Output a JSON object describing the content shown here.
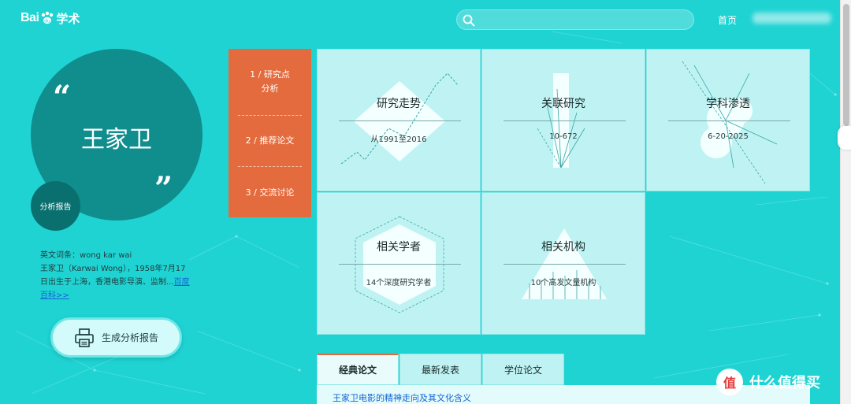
{
  "header": {
    "logo_text": "Bai",
    "logo_suffix": "学术",
    "search_placeholder": "",
    "nav_home": "首页"
  },
  "profile": {
    "name": "王家卫",
    "report_badge": "分析报告",
    "bio_line1": "英文词条：wong kar wai",
    "bio_line2": "王家卫（Karwai Wong），1958年7月17日出生于上海，香港电影导演、监制...",
    "bio_link": "百度百科>>",
    "generate_button": "生成分析报告"
  },
  "menu": {
    "items": [
      {
        "label_line1": "1 / 研究点",
        "label_line2": "分析"
      },
      {
        "label_line1": "2 / 推荐论文",
        "label_line2": ""
      },
      {
        "label_line1": "3 / 交流讨论",
        "label_line2": ""
      }
    ]
  },
  "tiles": [
    {
      "title": "研究走势",
      "subtitle": "从1991至2016"
    },
    {
      "title": "关联研究",
      "subtitle": "10-672"
    },
    {
      "title": "学科渗透",
      "subtitle": "6-20-2025"
    },
    {
      "title": "相关学者",
      "subtitle": "14个深度研究学者"
    },
    {
      "title": "相关机构",
      "subtitle": "10个高发文量机构"
    }
  ],
  "paper_tabs": [
    {
      "label": "经典论文",
      "active": true
    },
    {
      "label": "最新发表",
      "active": false
    },
    {
      "label": "学位论文",
      "active": false
    }
  ],
  "papers": [
    {
      "title": "王家卫电影的精神走向及其文化含义"
    }
  ],
  "watermark": {
    "badge": "值",
    "text": "什么值得买"
  },
  "colors": {
    "background": "#20d3d3",
    "profile_circle": "#108d8d",
    "menu_orange": "#e46b3d",
    "tile": "#bff3f3",
    "link": "#1464d6"
  },
  "icons": [
    "search-icon",
    "paw-icon",
    "printer-icon",
    "quote-open-icon",
    "quote-close-icon"
  ]
}
